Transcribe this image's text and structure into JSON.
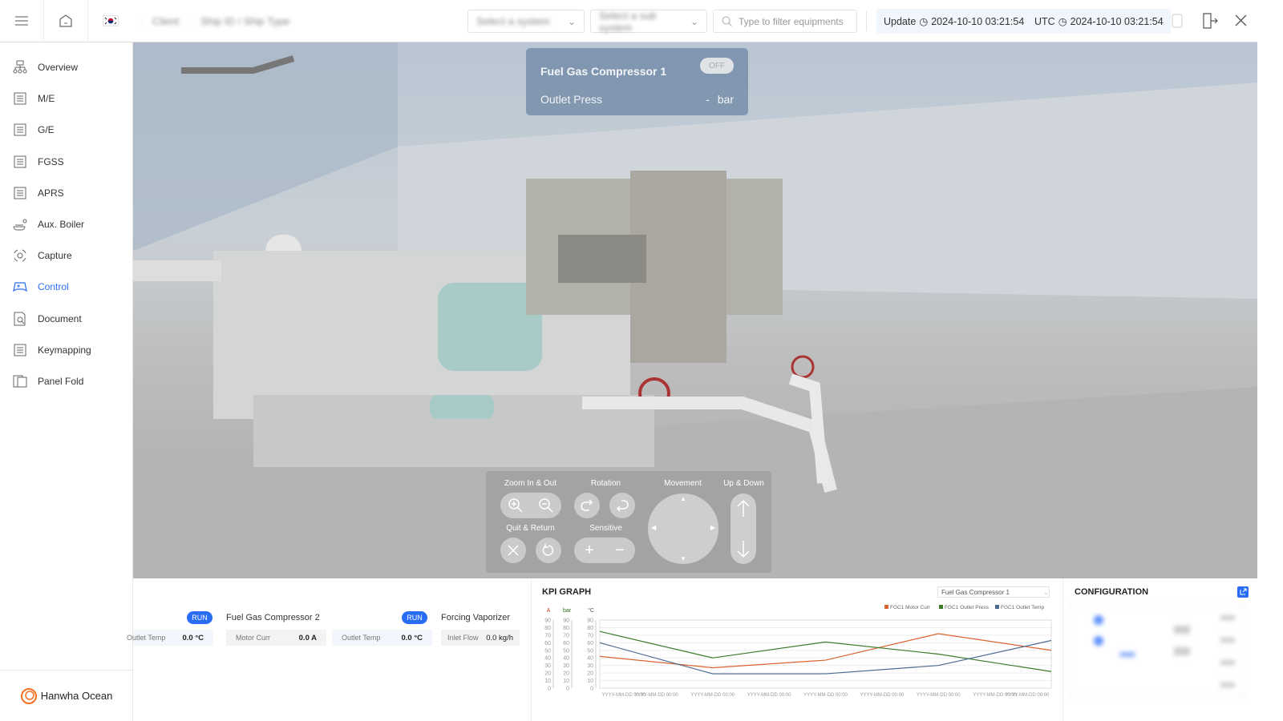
{
  "topbar": {
    "breadcrumb": [
      "Client",
      "Ship ID / Ship Type"
    ],
    "select_system_placeholder": "Select a system",
    "select_sub_placeholder": "Select a sub system",
    "filter_placeholder": "Type to filter equipments",
    "update_label": "Update",
    "update_time": "2024-10-10 03:21:54",
    "utc_label": "UTC",
    "utc_time": "2024-10-10 03:21:54"
  },
  "sidebar": {
    "items": [
      {
        "label": "Overview",
        "icon": "overview-icon"
      },
      {
        "label": "M/E",
        "icon": "main-engine-icon"
      },
      {
        "label": "G/E",
        "icon": "generator-engine-icon"
      },
      {
        "label": "FGSS",
        "icon": "fgss-icon"
      },
      {
        "label": "APRS",
        "icon": "aprs-icon"
      },
      {
        "label": "Aux. Boiler",
        "icon": "boiler-icon"
      },
      {
        "label": "Capture",
        "icon": "capture-icon"
      },
      {
        "label": "Control",
        "icon": "gamepad-icon",
        "active": true
      },
      {
        "label": "Document",
        "icon": "document-search-icon"
      },
      {
        "label": "Keymapping",
        "icon": "keymapping-icon"
      },
      {
        "label": "Panel Fold",
        "icon": "panel-fold-icon"
      }
    ],
    "logo": "Hanwha Ocean"
  },
  "overlay": {
    "title": "Fuel Gas Compressor 1",
    "status": "OFF",
    "param": "Outlet Press",
    "value": "-",
    "unit": "bar"
  },
  "controls": {
    "zoom": "Zoom In & Out",
    "rotation": "Rotation",
    "movement": "Movement",
    "updown": "Up & Down",
    "quit": "Quit & Return",
    "sensitive": "Sensitive"
  },
  "equipment": [
    {
      "name": "",
      "status": "RUN",
      "params": [
        {
          "label": "Outlet Temp",
          "value": "0.0 °C"
        }
      ]
    },
    {
      "name": "Fuel Gas Compressor 2",
      "status": "RUN",
      "params": [
        {
          "label": "Motor Curr",
          "value": "0.0 A"
        },
        {
          "label": "Outlet Temp",
          "value": "0.0 °C"
        }
      ]
    },
    {
      "name": "Forcing Vaporizer",
      "params": [
        {
          "label": "Inlet Flow",
          "value": "0.0 kg/h"
        }
      ]
    }
  ],
  "kpi": {
    "title": "KPI GRAPH",
    "selected": "Fuel Gas Compressor 1"
  },
  "config": {
    "title": "CONFIGURATION"
  },
  "chart_data": {
    "type": "line",
    "x": [
      "YYYY-MM-DD 00:00",
      "YYYY-MM-DD 00:00",
      "YYYY-MM-DD 00:00",
      "YYYY-MM-DD 00:00",
      "YYYY-MM-DD 00:00",
      "YYYY-MM-DD 00:00",
      "YYYY-MM-DD 00:00",
      "YYYY-MM-DD 00:00",
      "YYYY-MM-DD 00:00"
    ],
    "axes": [
      {
        "unit": "A",
        "color": "#c0441c"
      },
      {
        "unit": "bar",
        "color": "#2d6a1f"
      },
      {
        "unit": "°C",
        "color": "#555"
      }
    ],
    "ylim": [
      0,
      90
    ],
    "yticks": [
      0,
      10,
      20,
      30,
      40,
      50,
      60,
      70,
      80,
      90
    ],
    "series": [
      {
        "name": "FGC1 Motor Curr",
        "color": "#d9642e",
        "values": [
          42,
          27,
          37,
          72,
          50
        ]
      },
      {
        "name": "FGC1 Outlet Press",
        "color": "#3d7a2a",
        "values": [
          75,
          40,
          61,
          45,
          22
        ]
      },
      {
        "name": "FGC1 Outlet Temp",
        "color": "#4a6a8f",
        "values": [
          60,
          19,
          19,
          30,
          63
        ]
      }
    ],
    "legend": "top-right",
    "grid": true
  }
}
